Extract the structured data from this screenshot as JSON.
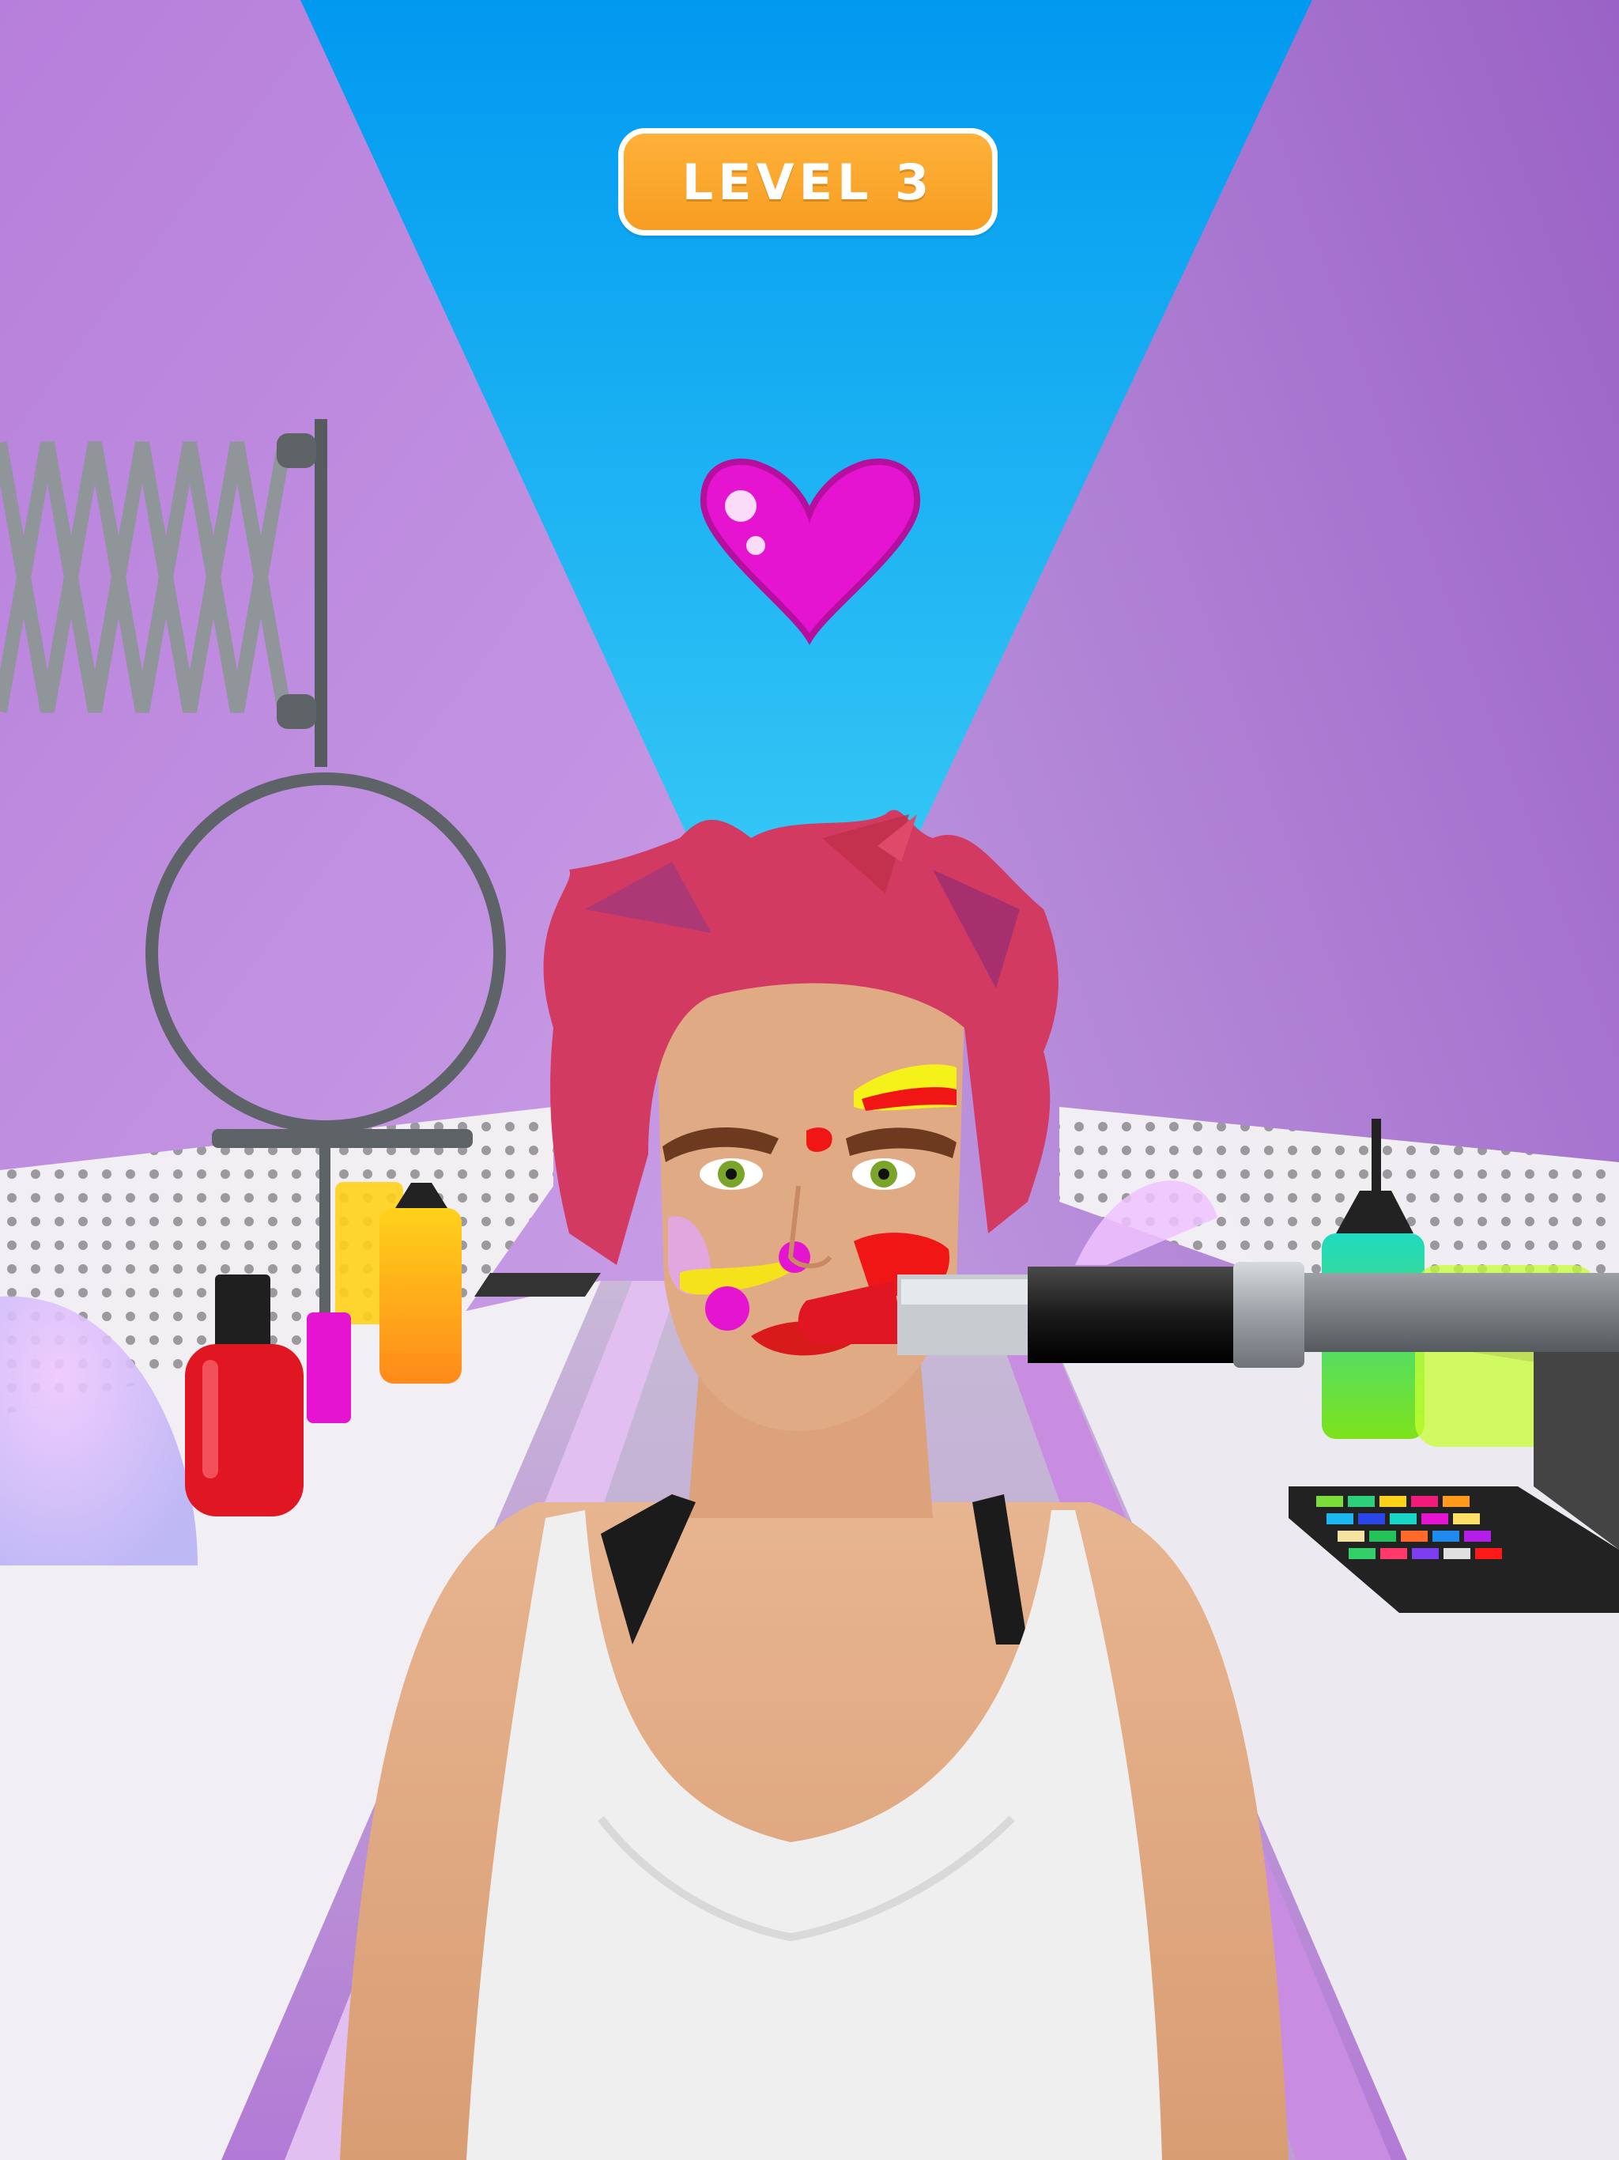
{
  "hud": {
    "level_label": "LEVEL 3"
  },
  "icons": {
    "heart": "heart-icon"
  },
  "colors": {
    "sky": "#1aa6f2",
    "wall": "#bf8fe0",
    "badge": "#f9a42a",
    "heart": "#e414d0",
    "lipstick": "#e01622",
    "tank_top": "#f2f2f2",
    "skin": "#e0ab84",
    "hair": "#d33a62"
  }
}
